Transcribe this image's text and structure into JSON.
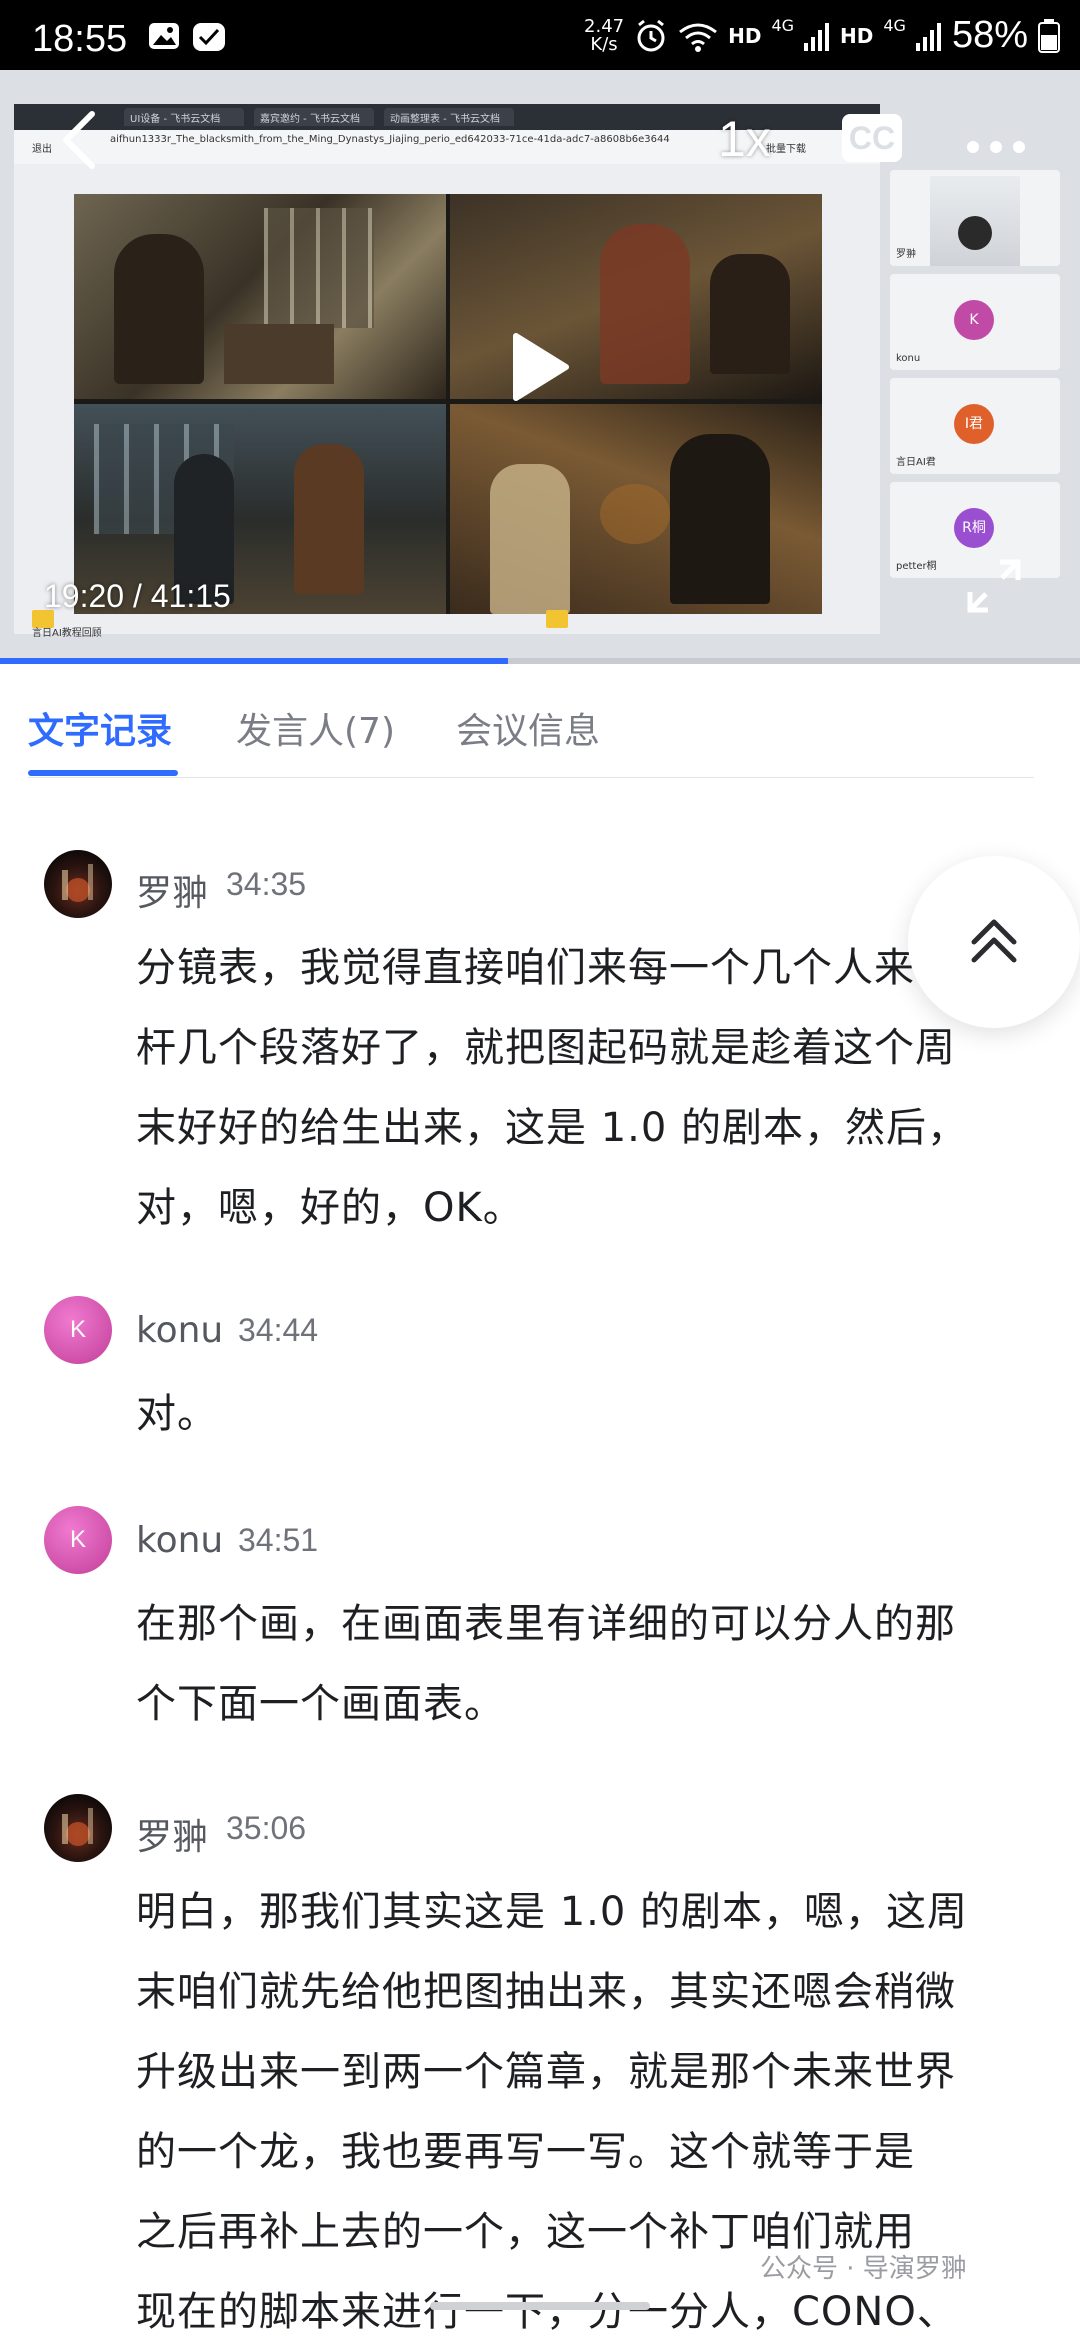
{
  "status_bar": {
    "time": "18:55",
    "net_speed_value": "2.47",
    "net_speed_unit": "K/s",
    "hd1": "HD",
    "hd2": "HD",
    "sig1": "4G",
    "sig2": "4G",
    "battery": "58%"
  },
  "video": {
    "speed_label": "1x",
    "cc_label": "CC",
    "current_time": "19:20 / 41:15",
    "progress": 0.47,
    "shared_screen": {
      "tabs": [
        "UI设备 - 飞书云文档",
        "嘉宾邀约 - 飞书云文档",
        "动画整理表 - 飞书云文档"
      ],
      "back_label": "退出",
      "filename": "aifhun1333r_The_blacksmith_from_the_Ming_Dynastys_Jiajing_perio_ed642033-71ce-41da-adc7-a8608b6e3644.png",
      "download_label": "批量下载",
      "bottom_label": "言日AI教程回顾",
      "participants": [
        {
          "name": "罗翀",
          "initial": ""
        },
        {
          "name": "konu",
          "initial": "K"
        },
        {
          "name": "言日AI君",
          "initial": "I君"
        },
        {
          "name": "petter桐",
          "initial": "R桐"
        }
      ]
    }
  },
  "tabs": [
    {
      "label": "文字记录",
      "active": true
    },
    {
      "label": "发言人(7)",
      "active": false
    },
    {
      "label": "会议信息",
      "active": false
    }
  ],
  "messages": [
    {
      "speaker": "罗翀",
      "time": "34:35",
      "avatar": "luo",
      "lines": [
        "分镜表，我觉得直接咱们来每一个几个人来",
        "杆几个段落好了，就把图起码就是趁着这个周",
        "末好好的给生出来，这是 1.0 的剧本，然后，",
        "对，嗯，好的，OK。"
      ]
    },
    {
      "speaker": "konu",
      "time": "34:44",
      "avatar": "K",
      "lines": [
        "对。"
      ]
    },
    {
      "speaker": "konu",
      "time": "34:51",
      "avatar": "K",
      "lines": [
        "在那个画，在画面表里有详细的可以分人的那",
        "个下面一个画面表。"
      ]
    },
    {
      "speaker": "罗翀",
      "time": "35:06",
      "avatar": "luo",
      "lines": [
        "明白，那我们其实这是 1.0 的剧本，嗯，这周",
        "末咱们就先给他把图抽出来，其实还嗯会稍微",
        "升级出来一到两一个篇章，就是那个未来世界",
        "的一个龙，我也要再写一写。这个就等于是",
        "之后再补上去的一个，这一个补丁咱们就用",
        "现在的脚本来进行一下，分一分人，CONO、"
      ]
    }
  ],
  "watermark": "公众号 · 导演罗翀"
}
